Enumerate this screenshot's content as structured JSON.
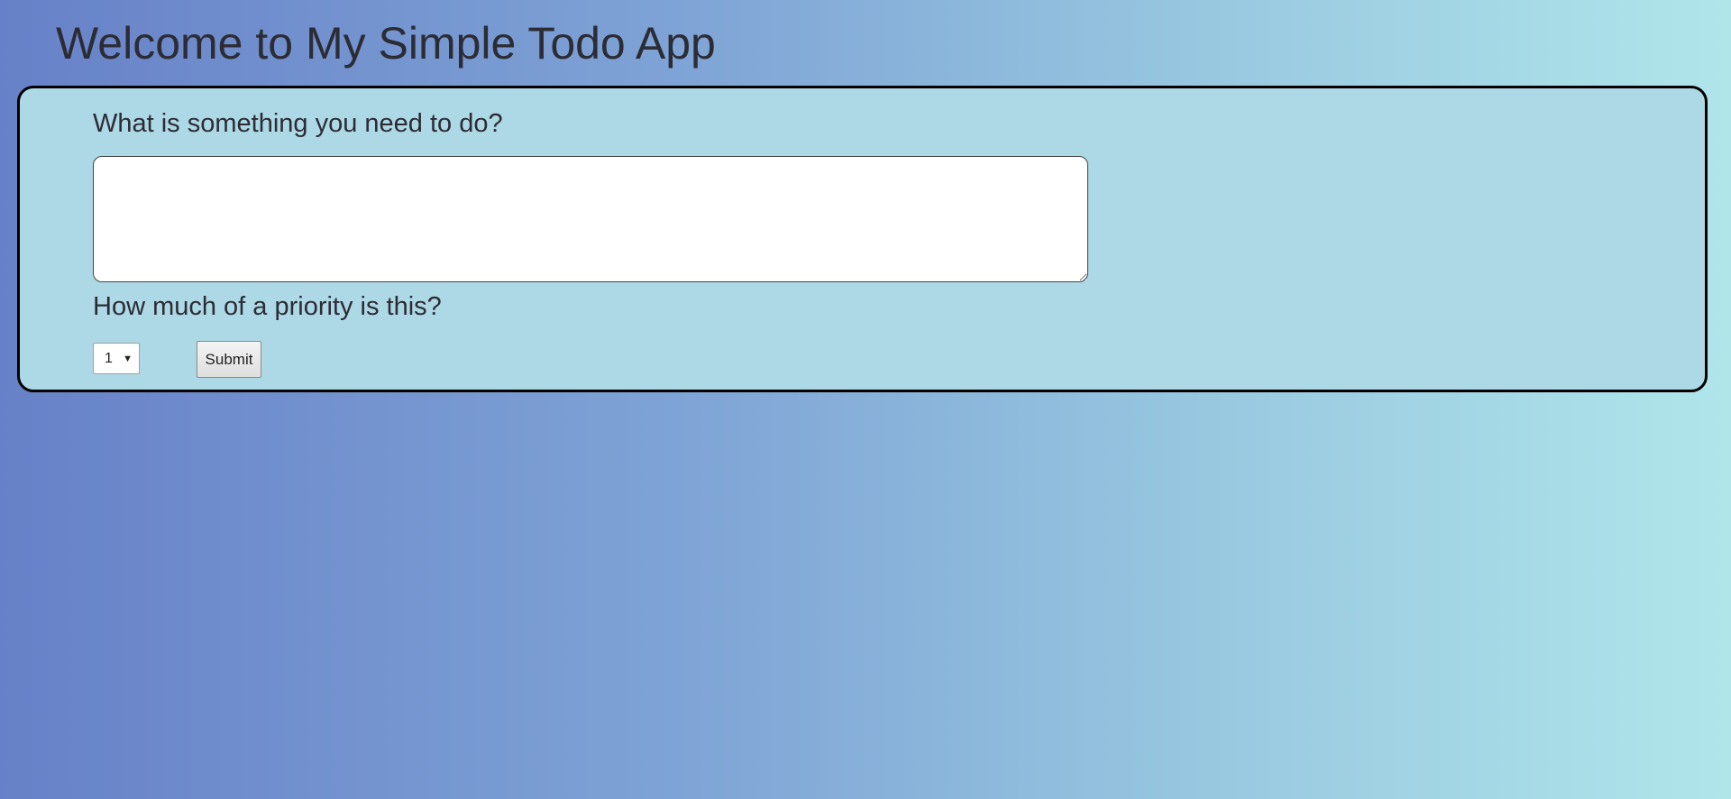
{
  "page": {
    "title": "Welcome to My Simple Todo App"
  },
  "form": {
    "task_label": "What is something you need to do?",
    "task_value": "",
    "priority_label": "How much of a priority is this?",
    "priority_selected": "1",
    "submit_label": "Submit"
  },
  "icons": {
    "select_arrow": "chevron-down-icon",
    "resize_grip": "resize-grip-icon"
  },
  "colors": {
    "panel_background": "#add8e6",
    "panel_border": "#000000",
    "gradient_start": "#6781c8",
    "gradient_end": "#b0e6ea",
    "text": "#2c2c34"
  }
}
